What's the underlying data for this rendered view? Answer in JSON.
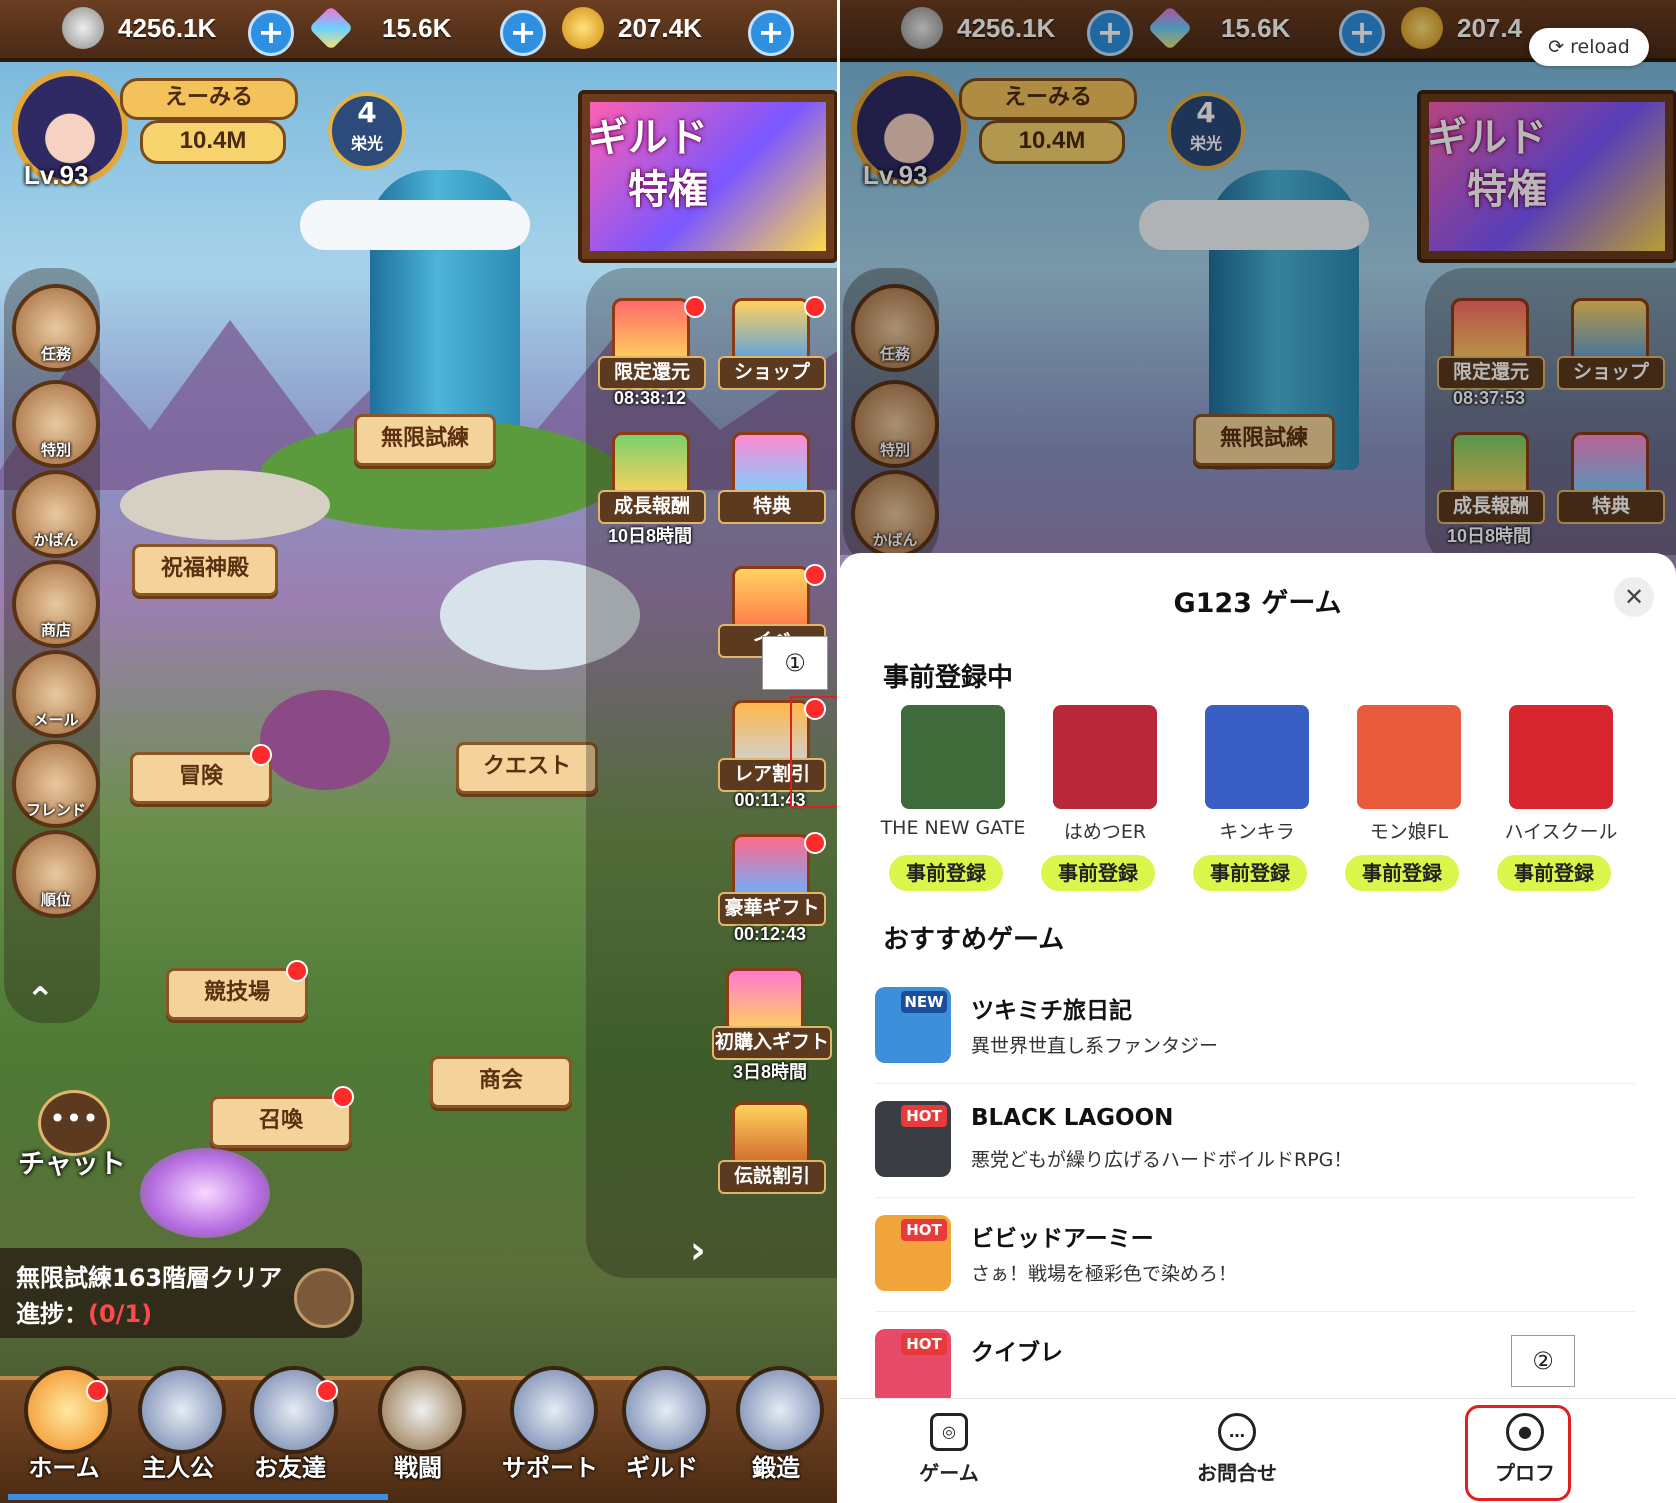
{
  "resources": [
    {
      "icon": "silver-coin-icon",
      "value": "4256.1K"
    },
    {
      "icon": "diamond-icon",
      "value": "15.6K"
    },
    {
      "icon": "gold-coin-icon",
      "value": "207.4K"
    }
  ],
  "resources_right_partial": {
    "gold": "207.4"
  },
  "profile": {
    "name": "えーみる",
    "power": "10.4M",
    "level": "Lv.93",
    "glory_num": "4",
    "glory_label": "栄光"
  },
  "banner": {
    "line1": "ギルド",
    "line2": "特権"
  },
  "left_menu": [
    "任務",
    "特別",
    "かばん",
    "商店",
    "メール",
    "フレンド",
    "順位"
  ],
  "places": [
    "無限試練",
    "祝福神殿",
    "冒険",
    "クエスト",
    "競技場",
    "商会",
    "召喚"
  ],
  "right_menu": [
    {
      "label": "限定還元",
      "sub": "08:38:12"
    },
    {
      "label": "ショップ",
      "sub": ""
    },
    {
      "label": "成長報酬",
      "sub": "10日8時間"
    },
    {
      "label": "特典",
      "sub": ""
    },
    {
      "label": "イベ",
      "sub": ""
    },
    {
      "label": "レア割引",
      "sub": "00:11:43"
    },
    {
      "label": "豪華ギフト",
      "sub": "00:12:43"
    },
    {
      "label": "初購入ギフト",
      "sub": "3日8時間"
    },
    {
      "label": "伝説割引",
      "sub": ""
    }
  ],
  "right_menu_right_panel": {
    "limited_timer": "08:37:53"
  },
  "annotations": {
    "one": "①",
    "two": "②"
  },
  "chat": {
    "label": "チャット"
  },
  "quest": {
    "title": "無限試練163階層クリア",
    "progress_label": "進捗：",
    "progress_value": "(0/1)"
  },
  "bottom_nav": [
    "ホーム",
    "主人公",
    "お友達",
    "戦闘",
    "サポート",
    "ギルド",
    "鍛造"
  ],
  "reload": {
    "label": "reload"
  },
  "sheet": {
    "title": "G123 ゲーム",
    "close_icon": "✕",
    "preregister_heading": "事前登録中",
    "preregister": [
      {
        "name": "THE NEW GATE",
        "button": "事前登録",
        "color": "#3f6b3a"
      },
      {
        "name": "はめつER",
        "button": "事前登録",
        "color": "#b8283a"
      },
      {
        "name": "キンキラ",
        "button": "事前登録",
        "color": "#3a5fc4"
      },
      {
        "name": "モン娘FL",
        "button": "事前登録",
        "color": "#e85a3c"
      },
      {
        "name": "ハイスクール",
        "button": "事前登録",
        "color": "#d8262e"
      }
    ],
    "recommended_heading": "おすすめゲーム",
    "recommended": [
      {
        "badge": "NEW",
        "name": "ツキミチ旅日記",
        "desc": "異世界世直し系ファンタジー",
        "color": "#3c8fd8",
        "badge_color": "#1a4e9a"
      },
      {
        "badge": "HOT",
        "name": "BLACK LAGOON",
        "desc": "悪党どもが繰り広げるハードボイルドRPG！",
        "color": "#3a3d44",
        "badge_color": "#e83a3a"
      },
      {
        "badge": "HOT",
        "name": "ビビッドアーミー",
        "desc": "さぁ！戦場を極彩色で染めろ！",
        "color": "#f0a43a",
        "badge_color": "#e83a3a"
      },
      {
        "badge": "HOT",
        "name": "クイブレ",
        "desc": "",
        "color": "#e84a6a",
        "badge_color": "#e83a3a"
      }
    ],
    "nav": [
      {
        "icon": "gamepad-icon",
        "label": "ゲーム"
      },
      {
        "icon": "chat-icon",
        "label": "お問合せ"
      },
      {
        "icon": "user-icon",
        "label": "プロフ"
      }
    ]
  }
}
